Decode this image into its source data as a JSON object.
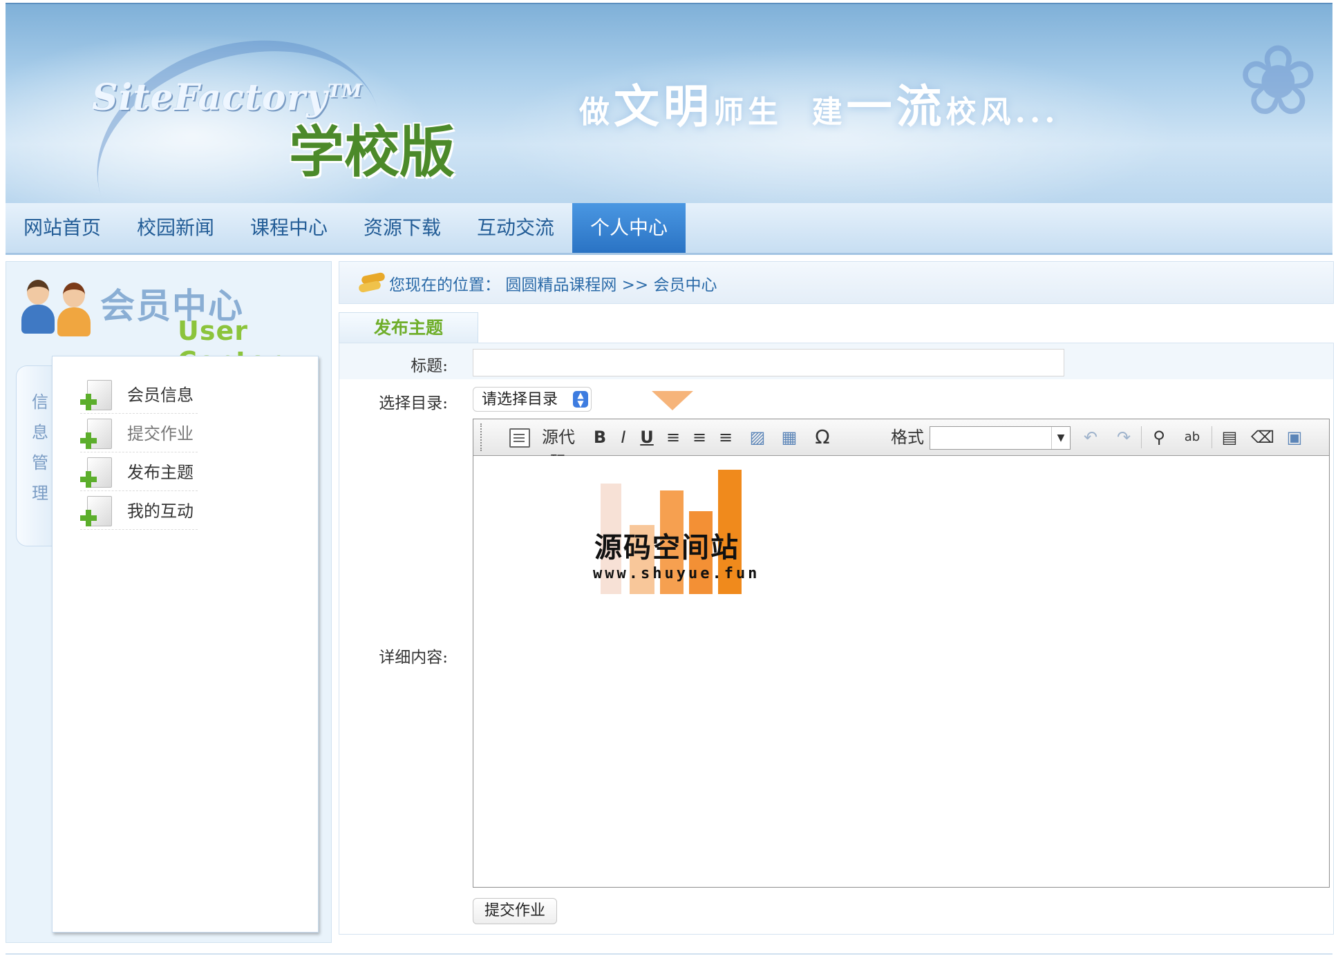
{
  "banner": {
    "logo_en": "SiteFactory",
    "logo_tm": "TM",
    "logo_cn": "学校版",
    "slogan_parts": [
      "做",
      "文明",
      "师生",
      "建",
      "一流",
      "校风..."
    ]
  },
  "nav": {
    "items": [
      {
        "label": "网站首页"
      },
      {
        "label": "校园新闻"
      },
      {
        "label": "课程中心"
      },
      {
        "label": "资源下载"
      },
      {
        "label": "互动交流"
      },
      {
        "label": "个人中心"
      }
    ],
    "active_index": 5
  },
  "sidebar": {
    "title_cn": "会员中心",
    "title_en": "User Center",
    "tab_chars": [
      "信",
      "息",
      "管",
      "理"
    ],
    "menu": [
      {
        "label": "会员信息"
      },
      {
        "label": "提交作业"
      },
      {
        "label": "发布主题"
      },
      {
        "label": "我的互动"
      }
    ]
  },
  "breadcrumb": {
    "prefix": "您现在的位置：",
    "site": "圆圆精品课程网",
    "sep": ">>",
    "current": "会员中心"
  },
  "form": {
    "tab": "发布主题",
    "title_label": "标题:",
    "title_value": "",
    "dir_label": "选择目录:",
    "dir_value": "请选择目录",
    "content_label": "详细内容:",
    "submit_label": "提交作业"
  },
  "toolbar": {
    "source_label": "源代码",
    "format_label": "格式",
    "format_value": "",
    "icons": [
      "source-code-icon",
      "bold-icon",
      "italic-icon",
      "underline-icon",
      "align-left-icon",
      "align-center-icon",
      "align-right-icon",
      "image-icon",
      "table-icon",
      "special-char-icon",
      "undo-icon",
      "redo-icon",
      "find-icon",
      "replace-icon",
      "select-all-icon",
      "eraser-icon",
      "fullscreen-icon"
    ]
  },
  "watermark": {
    "title": "源码空间站",
    "url": "www.shuyue.fun"
  },
  "colors": {
    "nav_active": "#2f7fd0",
    "link_blue": "#2a6aa8",
    "green_accent": "#6fae2a",
    "watermark_orange": "#f08a1c"
  }
}
